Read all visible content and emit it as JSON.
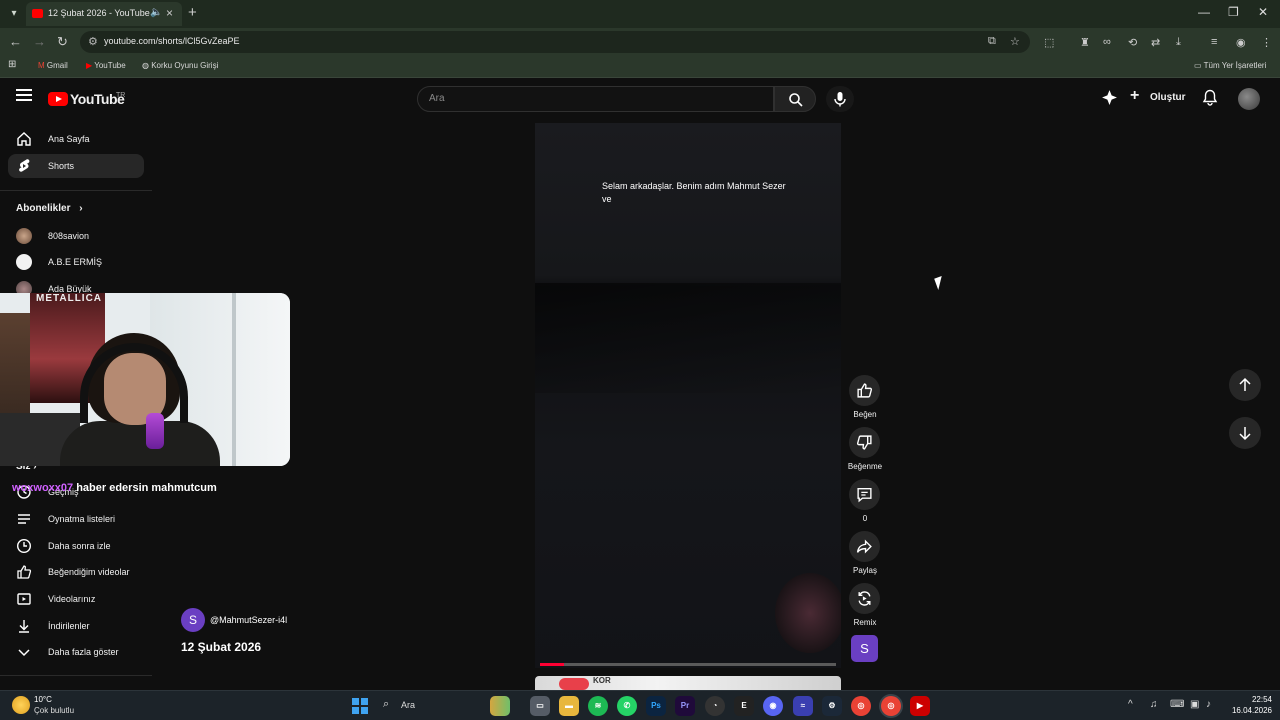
{
  "browser": {
    "tab_title": "12 Şubat 2026 - YouTube",
    "url": "youtube.com/shorts/lCl5GvZeaPE",
    "bookmarks": [
      "Gmail",
      "YouTube",
      "Korku Oyunu Girişi"
    ],
    "all_bookmarks": "Tüm Yer İşaretleri"
  },
  "header": {
    "logo_text": "YouTube",
    "logo_country": "TR",
    "search_placeholder": "Ara",
    "create_label": "Oluştur"
  },
  "sidebar": {
    "main_items": [
      {
        "label": "Ana Sayfa",
        "icon": "home-icon"
      },
      {
        "label": "Shorts",
        "icon": "shorts-icon",
        "active": true
      }
    ],
    "subscriptions_title": "Abonelikler",
    "subscriptions": [
      {
        "name": "808savion"
      },
      {
        "name": "A.B.E ERMİŞ"
      },
      {
        "name": "Ada Büyük"
      }
    ],
    "you_title": "Siz",
    "you_items": [
      {
        "label": "Geçmiş",
        "icon": "history-icon"
      },
      {
        "label": "Oynatma listeleri",
        "icon": "playlist-icon"
      },
      {
        "label": "Daha sonra izle",
        "icon": "watch-later-icon"
      },
      {
        "label": "Beğendiğim videolar",
        "icon": "like-icon"
      },
      {
        "label": "Videolarınız",
        "icon": "video-icon"
      },
      {
        "label": "İndirilenler",
        "icon": "download-icon"
      },
      {
        "label": "Daha fazla göster",
        "icon": "chevron-down-icon"
      }
    ]
  },
  "webcam": {
    "poster_text": "METALLICA",
    "chat_user": "woxwoxx07",
    "chat_message": "haber edersin mahmutcum"
  },
  "short": {
    "caption": "Selam arkadaşlar. Benim adım Mahmut Sezer ve",
    "channel_handle": "@MahmutSezer-i4l",
    "channel_initial": "S",
    "title": "12 Şubat 2026",
    "progress": 0.08,
    "next_thumb_text": "KOR"
  },
  "actions": {
    "like": "Beğen",
    "dislike": "Beğenme",
    "comments": "0",
    "share": "Paylaş",
    "remix": "Remix"
  },
  "taskbar": {
    "temperature": "10°C",
    "weather": "Çok bulutlu",
    "search_label": "Ara",
    "time": "22:54",
    "date": "16.04.2026"
  },
  "colors": {
    "youtube_red": "#ff0000",
    "progress_red": "#ff0033",
    "chat_user_purple": "#d061ff",
    "channel_purple": "#6a3fc2"
  }
}
